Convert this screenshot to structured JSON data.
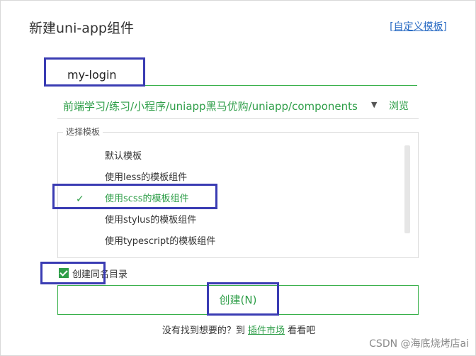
{
  "dialog": {
    "title": "新建uni-app组件",
    "custom_template_link": "自定义模板",
    "bracket_open": "[",
    "bracket_close": "]"
  },
  "name_input": {
    "value": "my-login"
  },
  "path": {
    "value": "前端学习/练习/小程序/uniapp黑马优购/uniapp/components",
    "dropdown_icon": "caret-down-icon",
    "browse_label": "浏览"
  },
  "templates": {
    "legend": "选择模板",
    "items": [
      {
        "label": "默认模板"
      },
      {
        "label": "使用less的模板组件"
      },
      {
        "label": "使用scss的模板组件"
      },
      {
        "label": "使用stylus的模板组件"
      },
      {
        "label": "使用typescript的模板组件"
      }
    ],
    "selected_index": 2,
    "check_icon": "checkmark-icon"
  },
  "create_dir": {
    "label": "创建同名目录",
    "checked": true
  },
  "create_button": {
    "label": "创建(N)"
  },
  "footer": {
    "prefix": "没有找到想要的？到 ",
    "link": "插件市场",
    "suffix": " 看看吧"
  },
  "watermark": "CSDN @海底烧烤店ai",
  "colors": {
    "accent": "#2e9e48",
    "annotation": "#3a3cb3",
    "link": "#2b6cc4"
  }
}
